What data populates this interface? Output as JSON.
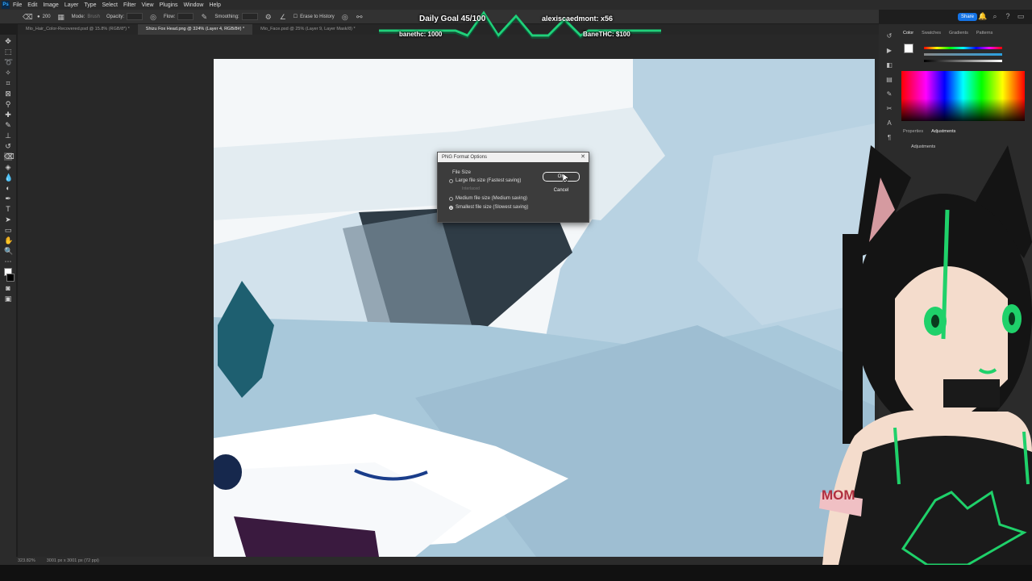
{
  "app": {
    "menu": [
      "File",
      "Edit",
      "Image",
      "Layer",
      "Type",
      "Select",
      "Filter",
      "View",
      "Plugins",
      "Window",
      "Help"
    ],
    "share_label": "Share"
  },
  "options_bar": {
    "brush_size": "200",
    "mode_label": "Mode:",
    "mode_value": "Brush",
    "opacity_label": "Opacity:",
    "flow_label": "Flow:",
    "smoothing_label": "Smoothing:",
    "erase_history_label": "Erase to History"
  },
  "tabs": [
    {
      "label": "Mio_Hair_Color-Recovered.psd @ 15.8% (RGB/8*) *"
    },
    {
      "label": "Shizu Fox Head.png @ 324% (Layer 4, RGB/8#) *"
    },
    {
      "label": "Mio_Face.psd @ 25% (Layer 9, Layer Mask/8) *"
    }
  ],
  "status": {
    "zoom": "323.82%",
    "doc_info": "3001 px x 3001 px (72 ppi)"
  },
  "color_panel": {
    "tabs": [
      "Color",
      "Swatches",
      "Gradients",
      "Patterns"
    ]
  },
  "props_panel": {
    "tabs": [
      "Properties",
      "Adjustments"
    ],
    "title": "Adjustments"
  },
  "dialog": {
    "title": "PNG Format Options",
    "group_label": "File Size",
    "options": [
      {
        "label": "Large file size (Fastest saving)",
        "checked": false
      },
      {
        "label": "Medium file size (Medium saving)",
        "checked": false
      },
      {
        "label": "Smallest file size (Slowest saving)",
        "checked": true
      }
    ],
    "interlaced_label": "Interlaced",
    "ok_label": "OK",
    "cancel_label": "Cancel"
  },
  "stream_overlay": {
    "goal": "Daily Goal 45/100",
    "donor": "alexiscaedmont: x56",
    "banethc": "banethc: 1000",
    "banethc_money": "BaneTHC: $100"
  },
  "avatar": {
    "band_text": "MOM"
  }
}
